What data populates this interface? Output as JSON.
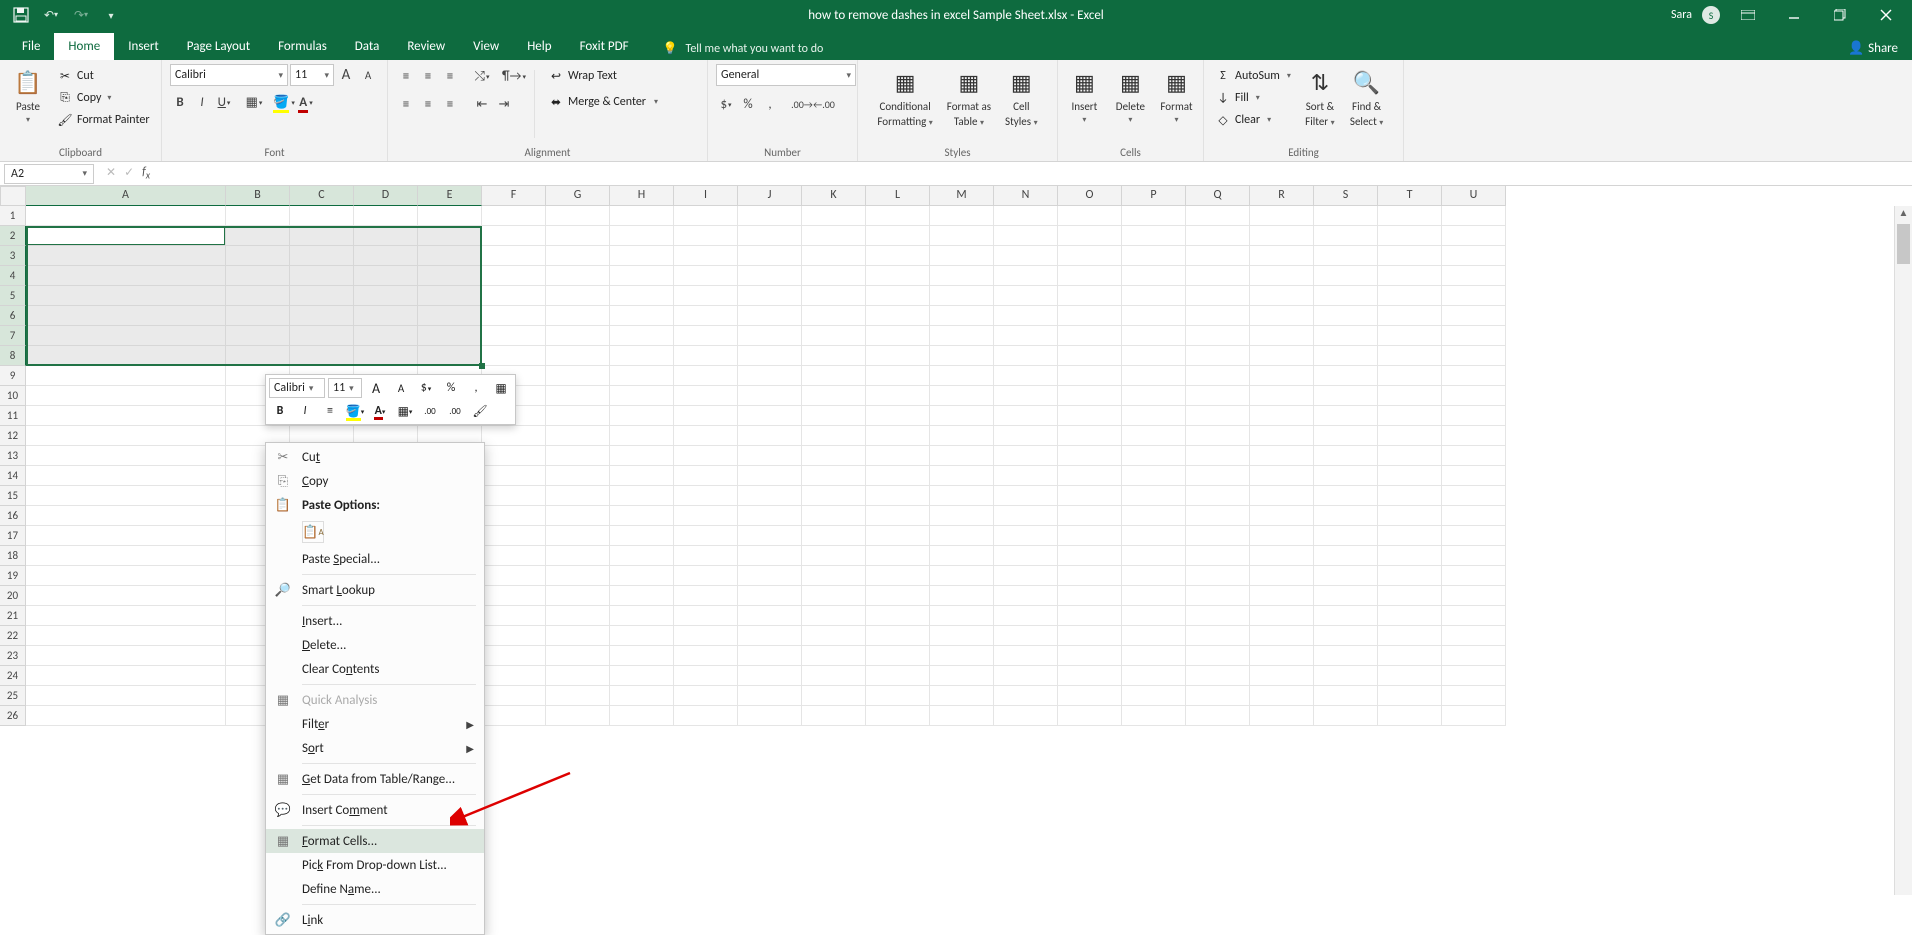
{
  "title": "how to remove dashes in excel Sample Sheet.xlsx  -  Excel",
  "user": {
    "name": "Sara",
    "initial": "S"
  },
  "qat": {
    "save": "💾",
    "undo": "↶",
    "redo": "↷",
    "customize": "▾"
  },
  "tabs": {
    "file": "File",
    "home": "Home",
    "insert": "Insert",
    "page_layout": "Page Layout",
    "formulas": "Formulas",
    "data": "Data",
    "review": "Review",
    "view": "View",
    "help": "Help",
    "foxit": "Foxit PDF"
  },
  "tellme": "Tell me what you want to do",
  "share": "Share",
  "ribbon": {
    "clipboard": {
      "label": "Clipboard",
      "paste": "Paste",
      "cut": "Cut",
      "copy": "Copy",
      "format_painter": "Format Painter"
    },
    "font": {
      "label": "Font",
      "name": "Calibri",
      "size": "11"
    },
    "alignment": {
      "label": "Alignment",
      "wrap": "Wrap Text",
      "merge": "Merge & Center"
    },
    "number": {
      "label": "Number",
      "format": "General"
    },
    "styles": {
      "label": "Styles",
      "conditional1": "Conditional",
      "conditional2": "Formatting",
      "formatas1": "Format as",
      "formatas2": "Table",
      "cell1": "Cell",
      "cell2": "Styles"
    },
    "cells": {
      "label": "Cells",
      "insert": "Insert",
      "delete": "Delete",
      "format": "Format"
    },
    "editing": {
      "label": "Editing",
      "autosum": "AutoSum",
      "fill": "Fill",
      "clear": "Clear",
      "sort1": "Sort &",
      "sort2": "Filter",
      "find1": "Find &",
      "find2": "Select"
    }
  },
  "namebox": "A2",
  "columns": [
    "A",
    "B",
    "C",
    "D",
    "E",
    "F",
    "G",
    "H",
    "I",
    "J",
    "K",
    "L",
    "M",
    "N",
    "O",
    "P",
    "Q",
    "R",
    "S",
    "T",
    "U"
  ],
  "col_widths": {
    "A": 200,
    "default": 64
  },
  "row_count": 26,
  "mini_toolbar": {
    "font": "Calibri",
    "size": "11"
  },
  "context_menu": {
    "cut": "Cut",
    "copy": "Copy",
    "paste_options": "Paste Options:",
    "paste_special": "Paste Special...",
    "smart_lookup": "Smart Lookup",
    "insert": "Insert...",
    "delete": "Delete...",
    "clear_contents": "Clear Contents",
    "quick_analysis": "Quick Analysis",
    "filter": "Filter",
    "sort": "Sort",
    "get_data": "Get Data from Table/Range...",
    "insert_comment": "Insert Comment",
    "format_cells": "Format Cells...",
    "pick_dropdown": "Pick From Drop-down List...",
    "define_name": "Define Name...",
    "link": "Link"
  }
}
